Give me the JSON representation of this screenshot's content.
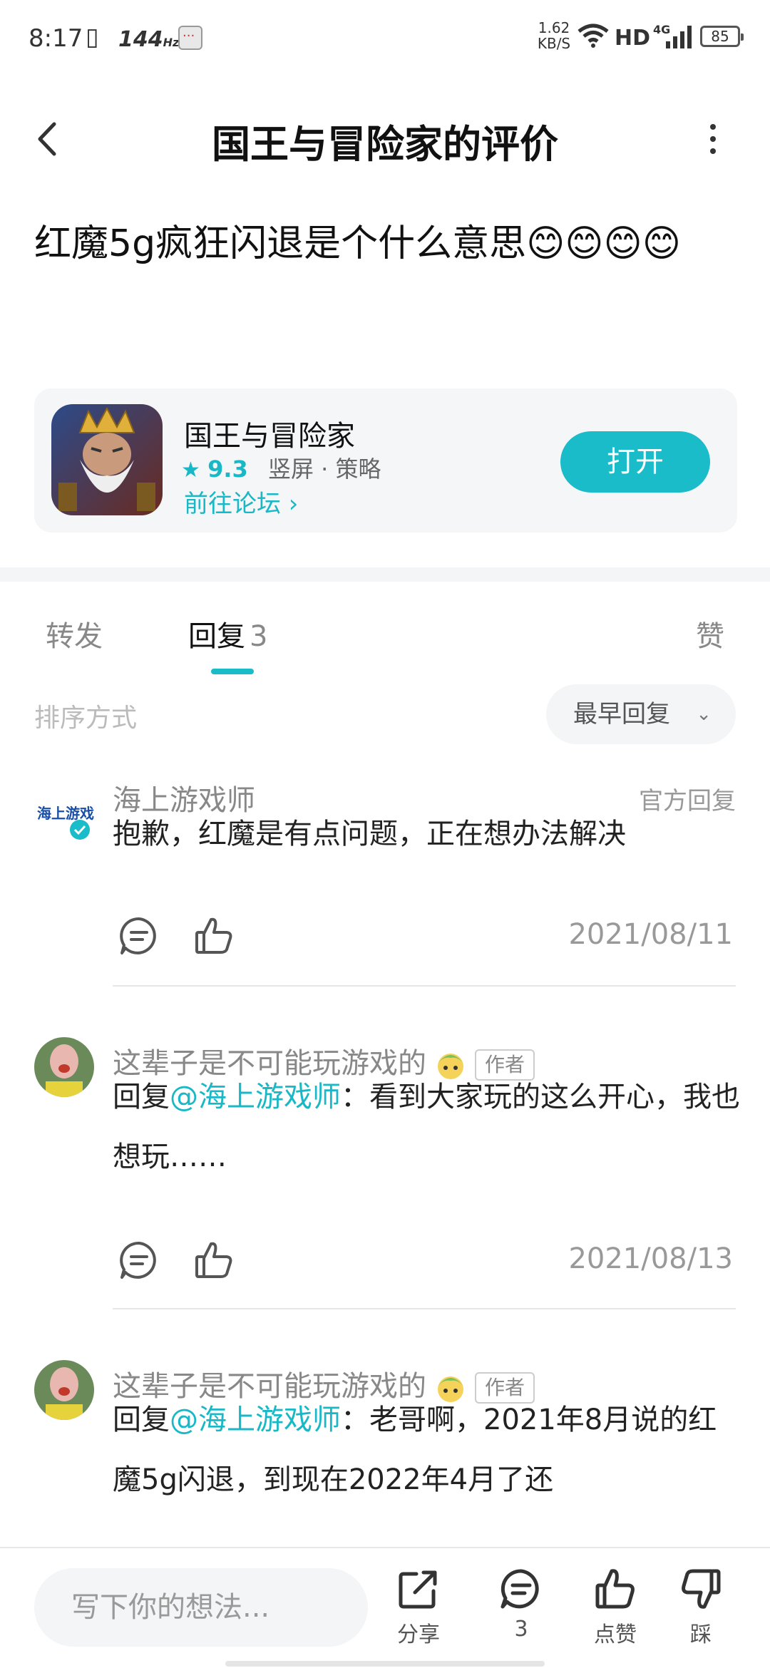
{
  "status_bar": {
    "time": "8:17",
    "refresh_rate": "144",
    "refresh_unit": "Hz",
    "net_speed_value": "1.62",
    "net_speed_unit": "KB/S",
    "hd": "HD",
    "network": "4G",
    "battery": "85"
  },
  "header": {
    "title": "国王与冒险家的评价"
  },
  "review": {
    "text": "红魔5g疯狂闪退是个什么意思😊😊😊😊"
  },
  "game_card": {
    "name": "国王与冒险家",
    "rating": "9.3",
    "tags": "竖屏 · 策略",
    "forum_link": "前往论坛 ›",
    "open_button": "打开"
  },
  "tabs": {
    "forward": "转发",
    "reply": "回复",
    "reply_count": "3",
    "like": "赞"
  },
  "sort": {
    "label": "排序方式",
    "selected": "最早回复"
  },
  "comments": [
    {
      "user": "海上游戏师",
      "official_tag": "官方回复",
      "avatar_text": "海上游戏",
      "text": "抱歉，红魔是有点问题，正在想办法解决",
      "date": "2021/08/11"
    },
    {
      "user": "这辈子是不可能玩游戏的",
      "author_badge": "作者",
      "reply_prefix": "回复",
      "mention": "@海上游戏师",
      "text": "：看到大家玩的这么开心，我也想玩……",
      "date": "2021/08/13"
    },
    {
      "user": "这辈子是不可能玩游戏的",
      "author_badge": "作者",
      "reply_prefix": "回复",
      "mention": "@海上游戏师",
      "text": "：老哥啊，2021年8月说的红魔5g闪退，到现在2022年4月了还"
    }
  ],
  "bottom_bar": {
    "input_placeholder": "写下你的想法...",
    "share": "分享",
    "comment_count": "3",
    "like": "点赞",
    "dislike": "踩"
  },
  "colors": {
    "accent": "#19bcc8"
  }
}
